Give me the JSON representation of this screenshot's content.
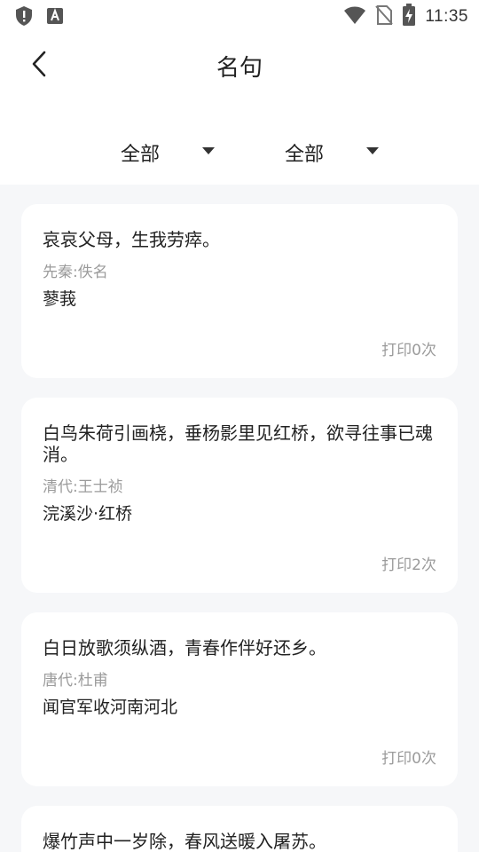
{
  "status_bar": {
    "time": "11:35",
    "left_icons": [
      "shield-alert-icon",
      "font-a-icon"
    ],
    "right_icons": [
      "wifi-icon",
      "no-sim-icon",
      "battery-charging-icon"
    ]
  },
  "header": {
    "title": "名句",
    "back_icon": "chevron-left-icon"
  },
  "filters": [
    {
      "label": "全部",
      "icon": "caret-down-icon"
    },
    {
      "label": "全部",
      "icon": "caret-down-icon"
    }
  ],
  "quotes": [
    {
      "text": "哀哀父母，生我劳瘁。",
      "author": "先秦:佚名",
      "work": "蓼莪",
      "prints": "打印0次"
    },
    {
      "text": "白鸟朱荷引画桡，垂杨影里见红桥，欲寻往事已魂消。",
      "author": "清代:王士祯",
      "work": "浣溪沙·红桥",
      "prints": "打印2次"
    },
    {
      "text": "白日放歌须纵酒，青春作伴好还乡。",
      "author": "唐代:杜甫",
      "work": "闻官军收河南河北",
      "prints": "打印0次"
    },
    {
      "text": "爆竹声中一岁除，春风送暖入屠苏。",
      "author": "",
      "work": "",
      "prints": ""
    }
  ],
  "colors": {
    "background": "#f6f7f9",
    "card": "#ffffff",
    "text": "#222222",
    "muted": "#9b9b9b"
  }
}
